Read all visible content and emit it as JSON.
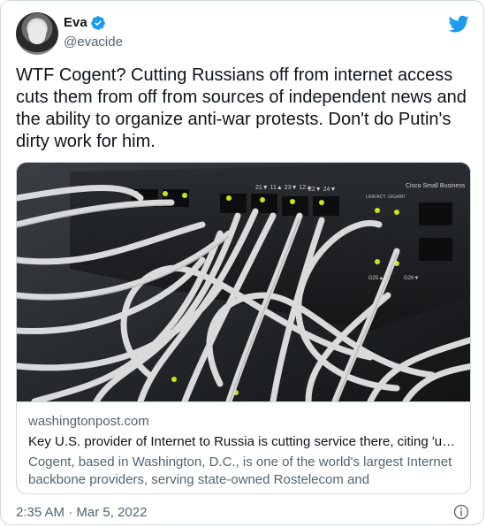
{
  "user": {
    "name": "Eva",
    "handle": "@evacide"
  },
  "tweet": {
    "text": "WTF Cogent? Cutting Russians off from internet access cuts them from off from sources of independent news and the ability to organize anti-war protests. Don't do Putin's dirty work for him."
  },
  "card": {
    "domain": "washingtonpost.com",
    "title": "Key U.S. provider of Internet to Russia is cutting service there, citing 'unpr…",
    "description": "Cogent, based in Washington, D.C., is one of the world's largest Internet backbone providers, serving state-owned Rostelecom and TransTelekom…",
    "image_text": {
      "brand": "Cisco Small Business",
      "ports_left": "21▼ 11▲ 23▼ 12▲",
      "ports_mid": "22▼ 24▼",
      "label_link": "LINK/ACT",
      "label_speed": "GIGABIT",
      "port_a": "G25▲",
      "port_b": "G26▼"
    }
  },
  "footer": {
    "timestamp": "2:35 AM · Mar 5, 2022"
  },
  "colors": {
    "twitter_blue": "#1d9bf0",
    "text_primary": "#0f1419",
    "text_secondary": "#536471",
    "border": "#cfd9de"
  },
  "icons": [
    "verified-icon",
    "twitter-bird-icon",
    "info-icon"
  ]
}
